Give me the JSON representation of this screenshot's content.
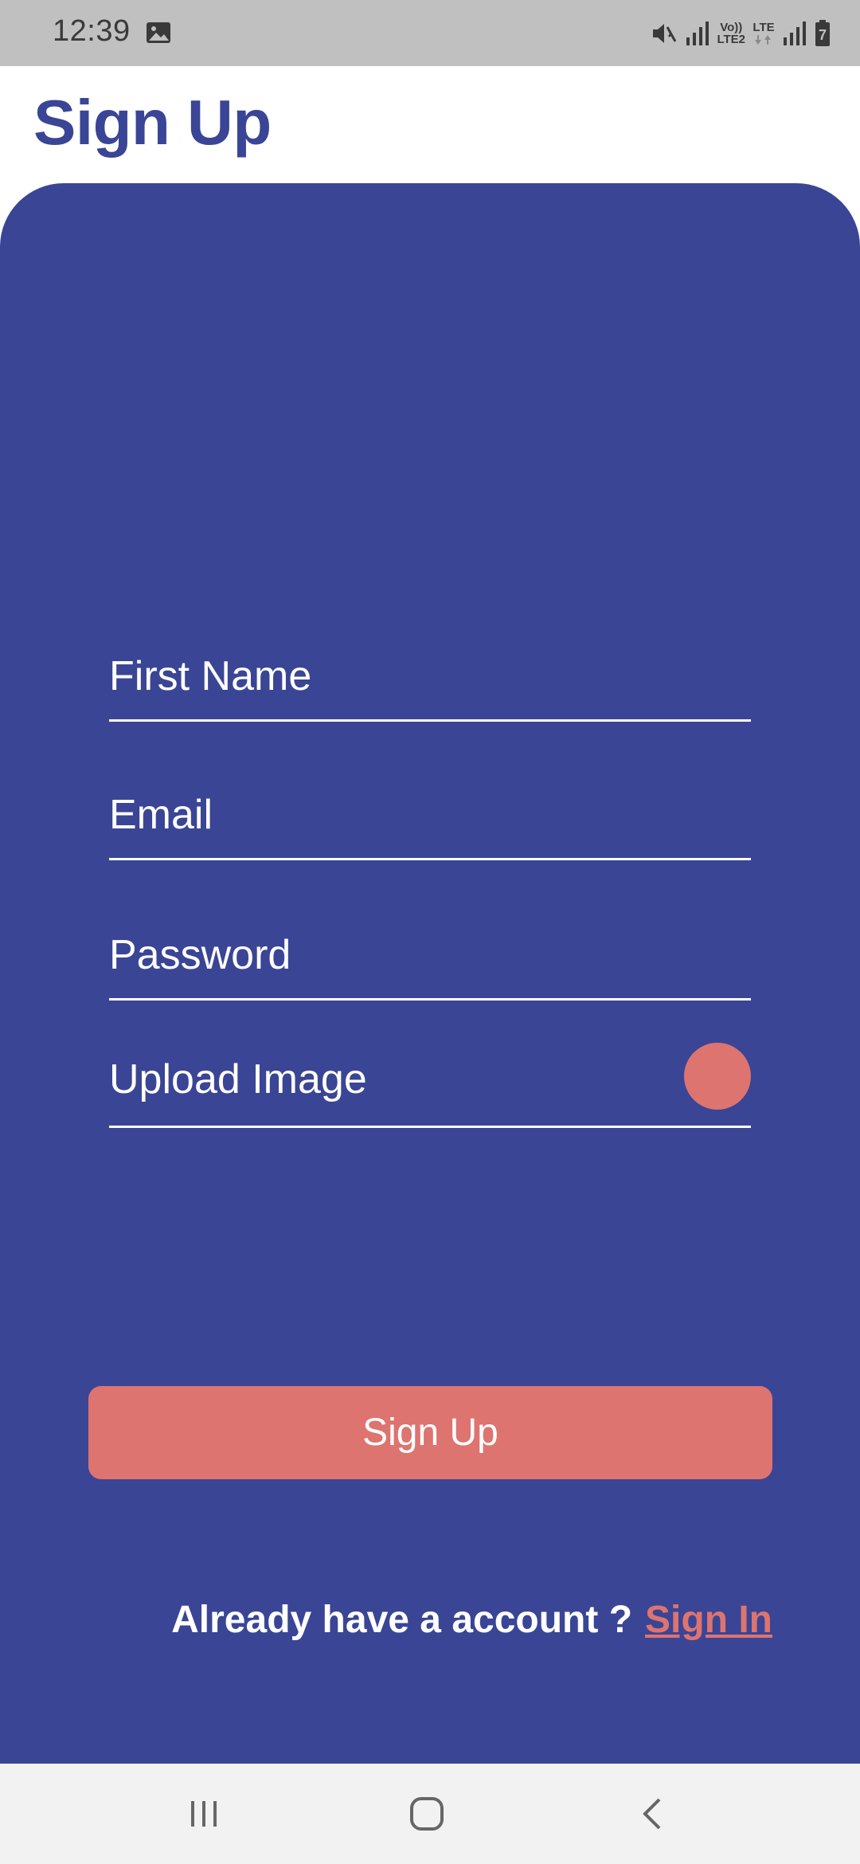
{
  "status_bar": {
    "time": "12:39",
    "icons": [
      "gallery-icon",
      "mute-icon",
      "signal-icon",
      "volte-lte2-icon",
      "lte-data-icon",
      "signal-icon",
      "battery-icon"
    ],
    "volte_label_top": "Vo))",
    "volte_label_bottom": "LTE2",
    "lte_label": "LTE",
    "battery_level": "7"
  },
  "header": {
    "title": "Sign Up"
  },
  "form": {
    "first_name_label": "First Name",
    "email_label": "Email",
    "password_label": "Password",
    "upload_label": "Upload Image",
    "submit_label": "Sign Up"
  },
  "footer": {
    "prompt": "Already have a account ?",
    "link": "Sign In"
  },
  "nav_bar": {
    "icons": [
      "recents-icon",
      "home-icon",
      "back-icon"
    ]
  },
  "colors": {
    "primary": "#3a4595",
    "accent": "#dd7470",
    "status_bar_bg": "#c0c0c0",
    "nav_bar_bg": "#f2f2f2",
    "text_on_primary": "#ffffff"
  }
}
